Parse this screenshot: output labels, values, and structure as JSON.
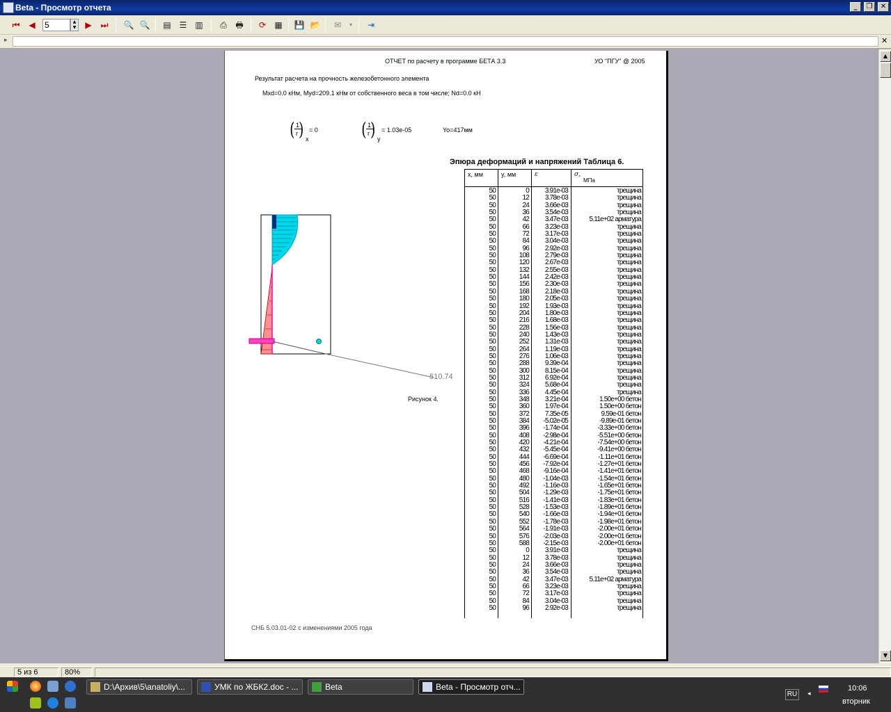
{
  "window": {
    "title": "Beta - Просмотр отчета",
    "min": "_",
    "max": "❐",
    "close": "✕"
  },
  "toolbar": {
    "page_value": "5"
  },
  "status": {
    "page_info": "5 из 6",
    "zoom": "80%"
  },
  "report": {
    "header": "ОТЧЕТ по расчету в программе БЕТА 3.3",
    "org": "УО \"ПГУ\"  @ 2005",
    "line1": "Результат расчета на прочность железобетонного элемента",
    "line2": "Mxd=0.0 кНм, Myd=209.1 кНм от собственного веса в том числе;     Nd=0.0 кН",
    "curv_x_label": "x",
    "curv_x_value": "=  0",
    "curv_y_label": "y",
    "curv_y_value": "=  1.03e-05",
    "y0": "Yo=417мм",
    "frac_num": "1",
    "frac_den": "r",
    "diagram_value": "510.74",
    "figure_caption": "Рисунок 4.",
    "table_title": "Эпюра деформаций и напряжений    Таблица 6.",
    "col_x": "x, мм",
    "col_y": "y, мм",
    "col_eps": "ε",
    "col_sigma": "σ,",
    "col_sigma_unit": "МПа",
    "footer": "СНБ 5.03.01-02 с изменениями 2005 года"
  },
  "table_rows": [
    [
      "50",
      "0",
      "3.91e-03",
      "трещина"
    ],
    [
      "50",
      "12",
      "3.78e-03",
      "трещина"
    ],
    [
      "50",
      "24",
      "3.66e-03",
      "трещина"
    ],
    [
      "50",
      "36",
      "3.54e-03",
      "трещина"
    ],
    [
      "50",
      "42",
      "3.47e-03",
      "5.11e+02 арматура"
    ],
    [
      "50",
      "66",
      "3.23e-03",
      "трещина"
    ],
    [
      "50",
      "72",
      "3.17e-03",
      "трещина"
    ],
    [
      "50",
      "84",
      "3.04e-03",
      "трещина"
    ],
    [
      "50",
      "96",
      "2.92e-03",
      "трещина"
    ],
    [
      "50",
      "108",
      "2.79e-03",
      "трещина"
    ],
    [
      "50",
      "120",
      "2.67e-03",
      "трещина"
    ],
    [
      "50",
      "132",
      "2.55e-03",
      "трещина"
    ],
    [
      "50",
      "144",
      "2.42e-03",
      "трещина"
    ],
    [
      "50",
      "156",
      "2.30e-03",
      "трещина"
    ],
    [
      "50",
      "168",
      "2.18e-03",
      "трещина"
    ],
    [
      "50",
      "180",
      "2.05e-03",
      "трещина"
    ],
    [
      "50",
      "192",
      "1.93e-03",
      "трещина"
    ],
    [
      "50",
      "204",
      "1.80e-03",
      "трещина"
    ],
    [
      "50",
      "216",
      "1.68e-03",
      "трещина"
    ],
    [
      "50",
      "228",
      "1.56e-03",
      "трещина"
    ],
    [
      "50",
      "240",
      "1.43e-03",
      "трещина"
    ],
    [
      "50",
      "252",
      "1.31e-03",
      "трещина"
    ],
    [
      "50",
      "264",
      "1.19e-03",
      "трещина"
    ],
    [
      "50",
      "276",
      "1.06e-03",
      "трещина"
    ],
    [
      "50",
      "288",
      "9.39e-04",
      "трещина"
    ],
    [
      "50",
      "300",
      "8.15e-04",
      "трещина"
    ],
    [
      "50",
      "312",
      "6.92e-04",
      "трещина"
    ],
    [
      "50",
      "324",
      "5.68e-04",
      "трещина"
    ],
    [
      "50",
      "336",
      "4.45e-04",
      "трещина"
    ],
    [
      "50",
      "348",
      "3.21e-04",
      "1.50e+00 бетон"
    ],
    [
      "50",
      "360",
      "1.97e-04",
      "1.50e+00 бетон"
    ],
    [
      "50",
      "372",
      "7.35e-05",
      "9.59e-01 бетон"
    ],
    [
      "50",
      "384",
      "-5.02e-05",
      "-9.89e-01 бетон"
    ],
    [
      "50",
      "396",
      "-1.74e-04",
      "-3.33e+00 бетон"
    ],
    [
      "50",
      "408",
      "-2.98e-04",
      "-5.51e+00 бетон"
    ],
    [
      "50",
      "420",
      "-4.21e-04",
      "-7.54e+00 бетон"
    ],
    [
      "50",
      "432",
      "-5.45e-04",
      "-9.41e+00 бетон"
    ],
    [
      "50",
      "444",
      "-6.69e-04",
      "-1.11e+01 бетон"
    ],
    [
      "50",
      "456",
      "-7.92e-04",
      "-1.27e+01 бетон"
    ],
    [
      "50",
      "468",
      "-9.16e-04",
      "-1.41e+01 бетон"
    ],
    [
      "50",
      "480",
      "-1.04e-03",
      "-1.54e+01 бетон"
    ],
    [
      "50",
      "492",
      "-1.16e-03",
      "-1.65e+01 бетон"
    ],
    [
      "50",
      "504",
      "-1.29e-03",
      "-1.75e+01 бетон"
    ],
    [
      "50",
      "516",
      "-1.41e-03",
      "-1.83e+01 бетон"
    ],
    [
      "50",
      "528",
      "-1.53e-03",
      "-1.89e+01 бетон"
    ],
    [
      "50",
      "540",
      "-1.66e-03",
      "-1.94e+01 бетон"
    ],
    [
      "50",
      "552",
      "-1.78e-03",
      "-1.98e+01 бетон"
    ],
    [
      "50",
      "564",
      "-1.91e-03",
      "-2.00e+01 бетон"
    ],
    [
      "50",
      "576",
      "-2.03e-03",
      "-2.00e+01 бетон"
    ],
    [
      "50",
      "588",
      "-2.15e-03",
      "-2.00e+01 бетон"
    ],
    [
      "50",
      "0",
      "3.91e-03",
      "трещина"
    ],
    [
      "50",
      "12",
      "3.78e-03",
      "трещина"
    ],
    [
      "50",
      "24",
      "3.66e-03",
      "трещина"
    ],
    [
      "50",
      "36",
      "3.54e-03",
      "трещина"
    ],
    [
      "50",
      "42",
      "3.47e-03",
      "5.11e+02 арматура"
    ],
    [
      "50",
      "66",
      "3.23e-03",
      "трещина"
    ],
    [
      "50",
      "72",
      "3.17e-03",
      "трещина"
    ],
    [
      "50",
      "84",
      "3.04e-03",
      "трещина"
    ],
    [
      "50",
      "96",
      "2.92e-03",
      "трещина"
    ]
  ],
  "taskbar": {
    "items": [
      {
        "label": "D:\\Архив\\5\\anatoliy\\..."
      },
      {
        "label": "УМК по ЖБК2.doc - ..."
      },
      {
        "label": "Beta"
      },
      {
        "label": "Beta - Просмотр отч..."
      }
    ],
    "lang": "RU",
    "time": "10:06",
    "day": "вторник"
  },
  "colors": {
    "titlebar": "#0a246a",
    "cyan": "#00c8d8",
    "red": "#c00000",
    "magenta": "#ff00c0"
  }
}
